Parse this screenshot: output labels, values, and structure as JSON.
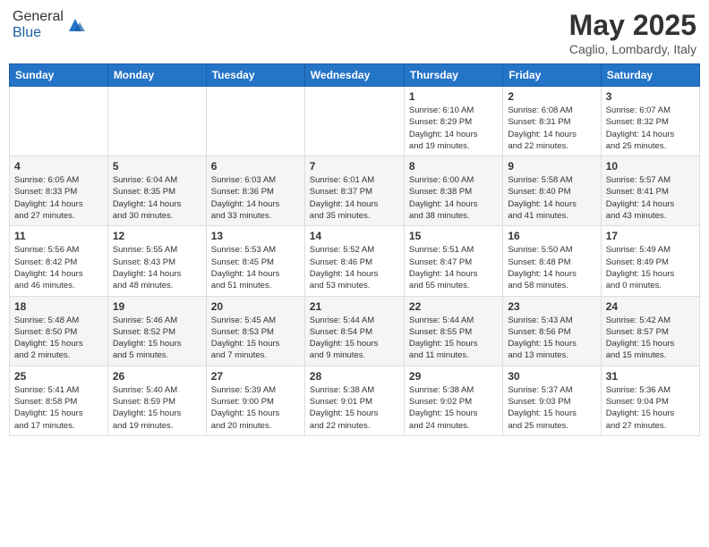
{
  "header": {
    "logo_general": "General",
    "logo_blue": "Blue",
    "month_year": "May 2025",
    "location": "Caglio, Lombardy, Italy"
  },
  "weekdays": [
    "Sunday",
    "Monday",
    "Tuesday",
    "Wednesday",
    "Thursday",
    "Friday",
    "Saturday"
  ],
  "weeks": [
    [
      {
        "day": "",
        "info": ""
      },
      {
        "day": "",
        "info": ""
      },
      {
        "day": "",
        "info": ""
      },
      {
        "day": "",
        "info": ""
      },
      {
        "day": "1",
        "info": "Sunrise: 6:10 AM\nSunset: 8:29 PM\nDaylight: 14 hours\nand 19 minutes."
      },
      {
        "day": "2",
        "info": "Sunrise: 6:08 AM\nSunset: 8:31 PM\nDaylight: 14 hours\nand 22 minutes."
      },
      {
        "day": "3",
        "info": "Sunrise: 6:07 AM\nSunset: 8:32 PM\nDaylight: 14 hours\nand 25 minutes."
      }
    ],
    [
      {
        "day": "4",
        "info": "Sunrise: 6:05 AM\nSunset: 8:33 PM\nDaylight: 14 hours\nand 27 minutes."
      },
      {
        "day": "5",
        "info": "Sunrise: 6:04 AM\nSunset: 8:35 PM\nDaylight: 14 hours\nand 30 minutes."
      },
      {
        "day": "6",
        "info": "Sunrise: 6:03 AM\nSunset: 8:36 PM\nDaylight: 14 hours\nand 33 minutes."
      },
      {
        "day": "7",
        "info": "Sunrise: 6:01 AM\nSunset: 8:37 PM\nDaylight: 14 hours\nand 35 minutes."
      },
      {
        "day": "8",
        "info": "Sunrise: 6:00 AM\nSunset: 8:38 PM\nDaylight: 14 hours\nand 38 minutes."
      },
      {
        "day": "9",
        "info": "Sunrise: 5:58 AM\nSunset: 8:40 PM\nDaylight: 14 hours\nand 41 minutes."
      },
      {
        "day": "10",
        "info": "Sunrise: 5:57 AM\nSunset: 8:41 PM\nDaylight: 14 hours\nand 43 minutes."
      }
    ],
    [
      {
        "day": "11",
        "info": "Sunrise: 5:56 AM\nSunset: 8:42 PM\nDaylight: 14 hours\nand 46 minutes."
      },
      {
        "day": "12",
        "info": "Sunrise: 5:55 AM\nSunset: 8:43 PM\nDaylight: 14 hours\nand 48 minutes."
      },
      {
        "day": "13",
        "info": "Sunrise: 5:53 AM\nSunset: 8:45 PM\nDaylight: 14 hours\nand 51 minutes."
      },
      {
        "day": "14",
        "info": "Sunrise: 5:52 AM\nSunset: 8:46 PM\nDaylight: 14 hours\nand 53 minutes."
      },
      {
        "day": "15",
        "info": "Sunrise: 5:51 AM\nSunset: 8:47 PM\nDaylight: 14 hours\nand 55 minutes."
      },
      {
        "day": "16",
        "info": "Sunrise: 5:50 AM\nSunset: 8:48 PM\nDaylight: 14 hours\nand 58 minutes."
      },
      {
        "day": "17",
        "info": "Sunrise: 5:49 AM\nSunset: 8:49 PM\nDaylight: 15 hours\nand 0 minutes."
      }
    ],
    [
      {
        "day": "18",
        "info": "Sunrise: 5:48 AM\nSunset: 8:50 PM\nDaylight: 15 hours\nand 2 minutes."
      },
      {
        "day": "19",
        "info": "Sunrise: 5:46 AM\nSunset: 8:52 PM\nDaylight: 15 hours\nand 5 minutes."
      },
      {
        "day": "20",
        "info": "Sunrise: 5:45 AM\nSunset: 8:53 PM\nDaylight: 15 hours\nand 7 minutes."
      },
      {
        "day": "21",
        "info": "Sunrise: 5:44 AM\nSunset: 8:54 PM\nDaylight: 15 hours\nand 9 minutes."
      },
      {
        "day": "22",
        "info": "Sunrise: 5:44 AM\nSunset: 8:55 PM\nDaylight: 15 hours\nand 11 minutes."
      },
      {
        "day": "23",
        "info": "Sunrise: 5:43 AM\nSunset: 8:56 PM\nDaylight: 15 hours\nand 13 minutes."
      },
      {
        "day": "24",
        "info": "Sunrise: 5:42 AM\nSunset: 8:57 PM\nDaylight: 15 hours\nand 15 minutes."
      }
    ],
    [
      {
        "day": "25",
        "info": "Sunrise: 5:41 AM\nSunset: 8:58 PM\nDaylight: 15 hours\nand 17 minutes."
      },
      {
        "day": "26",
        "info": "Sunrise: 5:40 AM\nSunset: 8:59 PM\nDaylight: 15 hours\nand 19 minutes."
      },
      {
        "day": "27",
        "info": "Sunrise: 5:39 AM\nSunset: 9:00 PM\nDaylight: 15 hours\nand 20 minutes."
      },
      {
        "day": "28",
        "info": "Sunrise: 5:38 AM\nSunset: 9:01 PM\nDaylight: 15 hours\nand 22 minutes."
      },
      {
        "day": "29",
        "info": "Sunrise: 5:38 AM\nSunset: 9:02 PM\nDaylight: 15 hours\nand 24 minutes."
      },
      {
        "day": "30",
        "info": "Sunrise: 5:37 AM\nSunset: 9:03 PM\nDaylight: 15 hours\nand 25 minutes."
      },
      {
        "day": "31",
        "info": "Sunrise: 5:36 AM\nSunset: 9:04 PM\nDaylight: 15 hours\nand 27 minutes."
      }
    ]
  ]
}
